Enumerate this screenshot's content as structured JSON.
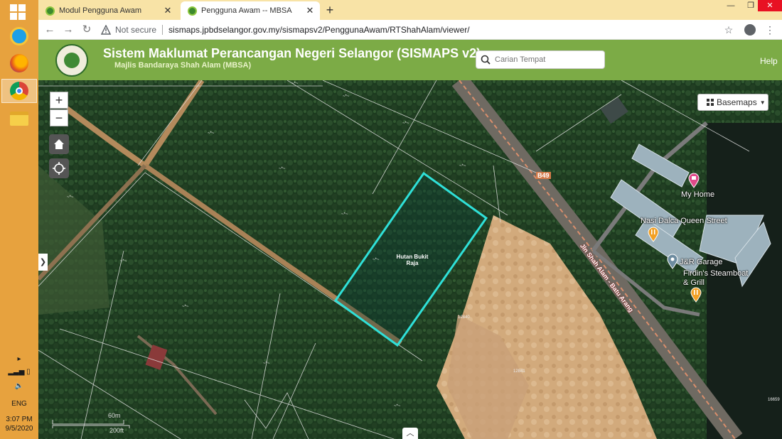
{
  "taskbar": {
    "tray_lang": "ENG",
    "tray_time": "3:07 PM",
    "tray_date": "9/5/2020"
  },
  "browser": {
    "tabs": [
      {
        "title": "Modul Pengguna Awam"
      },
      {
        "title": "Pengguna Awam -- MBSA"
      }
    ],
    "not_secure": "Not secure",
    "url": "sismaps.jpbdselangor.gov.my/sismapsv2/PenggunaAwam/RTShahAlam/viewer/"
  },
  "app": {
    "title": "Sistem Maklumat Perancangan Negeri Selangor (SISMAPS v2)",
    "subtitle": "Majlis Bandaraya Shah Alam (MBSA)",
    "search_placeholder": "Carian Tempat",
    "help_label": "Help"
  },
  "map": {
    "basemaps_label": "Basemaps",
    "zone_label": "Hutan Bukit Raja",
    "road_code": "B49",
    "road_name": "Jln Shah Alam - Batu Arang",
    "pois": {
      "my_home": "My Home",
      "nasi_dalca": "Nasi Dalca Queen Street",
      "jr_garage": "J&R Garage",
      "firdins": "Firdin's Steamboat & Grill"
    },
    "scale": {
      "metric": "60m",
      "imperial": "200ft"
    },
    "lot_numbers": [
      "12840",
      "12841",
      "16659"
    ],
    "highlight_color": "#2fe0d8"
  }
}
